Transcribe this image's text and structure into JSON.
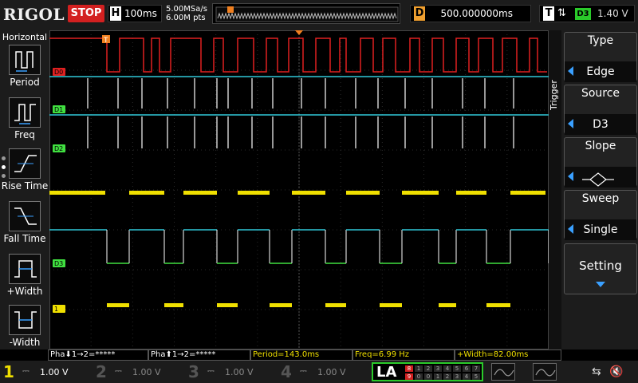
{
  "topbar": {
    "brand": "RIGOL",
    "run_state": "STOP",
    "timebase_letter": "H",
    "timebase": "100ms",
    "sample_rate": "5.00MSa/s",
    "memory_depth": "6.00M pts",
    "delay_letter": "D",
    "delay": "500.000000ms",
    "trigger_letter": "T",
    "trigger_edge": "⇅",
    "trigger_source": "D3",
    "trigger_level": "1.40 V"
  },
  "leftmenu": {
    "title": "Horizontal",
    "items": [
      {
        "label": "Period",
        "icon": "period-icon"
      },
      {
        "label": "Freq",
        "icon": "frequency-icon"
      },
      {
        "label": "Rise Time",
        "icon": "rise-time-icon"
      },
      {
        "label": "Fall Time",
        "icon": "fall-time-icon"
      },
      {
        "label": "+Width",
        "icon": "positive-width-icon"
      },
      {
        "label": "-Width",
        "icon": "negative-width-icon"
      }
    ]
  },
  "rightmenu": {
    "header": "Trigger",
    "items": [
      {
        "title": "Type",
        "value": "Edge"
      },
      {
        "title": "Source",
        "value": "D3"
      },
      {
        "title": "Slope",
        "value": "",
        "icon": "either-slope-icon"
      },
      {
        "title": "Sweep",
        "value": "Single"
      }
    ],
    "setting": "Setting"
  },
  "channel_labels": {
    "d0": "D0",
    "d1": "D1",
    "d2": "D2",
    "d3": "D3",
    "ch1": "1",
    "trigger_marker": "T"
  },
  "measurements": [
    {
      "text": "Pha⬇1→2=*****",
      "color": "white"
    },
    {
      "text": "Pha⬆1→2=*****",
      "color": "white"
    },
    {
      "text": "Period=143.0ms",
      "color": "yellow"
    },
    {
      "text": "Freq=6.99 Hz",
      "color": "yellow"
    },
    {
      "text": "+Width=82.00ms",
      "color": "yellow"
    }
  ],
  "channels": [
    {
      "num": "1",
      "scale": "1.00 V",
      "color": "#f0e000",
      "coupling": "⎓"
    },
    {
      "num": "2",
      "scale": "1.00 V",
      "color": "#555555",
      "coupling": "⎓"
    },
    {
      "num": "3",
      "scale": "1.00 V",
      "color": "#555555",
      "coupling": "⎓"
    },
    {
      "num": "4",
      "scale": "1.00 V",
      "color": "#555555",
      "coupling": "⎓"
    }
  ],
  "la": {
    "label": "LA",
    "bits_row1": [
      "8",
      "1",
      "2",
      "3",
      "4",
      "5",
      "6",
      "7"
    ],
    "bits_row2": [
      "9",
      "0",
      "0",
      "1",
      "2",
      "3",
      "4",
      "5"
    ]
  },
  "colors": {
    "digital_high": "#e02020",
    "digital_d1d2": "#ffffff",
    "digital_cyan": "#30c8d8",
    "digital_low_green": "#40e040",
    "analog_ch1": "#f0e000",
    "trigger_marker": "#f08020"
  }
}
